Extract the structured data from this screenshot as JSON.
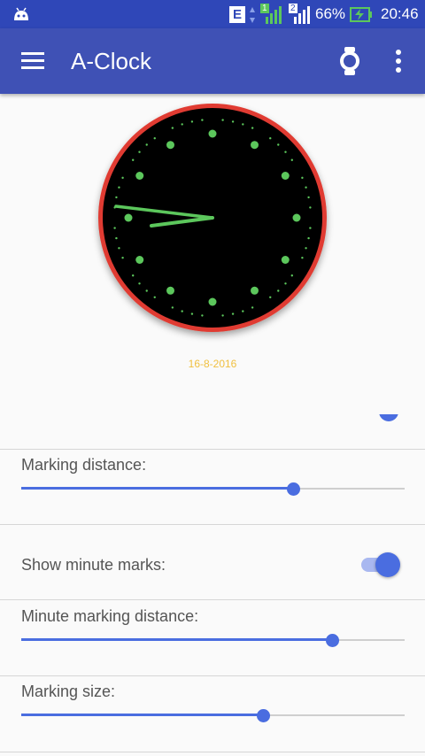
{
  "status_bar": {
    "network": "E",
    "sim1": "1",
    "sim2": "2",
    "battery": "66%",
    "time": "20:46"
  },
  "app_bar": {
    "title": "A-Clock"
  },
  "clock": {
    "date": "16-8-2016",
    "hour_hand_time": "9:45",
    "minute_hand_time": "9:45"
  },
  "settings": [
    {
      "label": "Marking distance:",
      "type": "slider",
      "value": 0.71
    },
    {
      "label": "Show minute marks:",
      "type": "toggle",
      "value": true
    },
    {
      "label": "Minute marking distance:",
      "type": "slider",
      "value": 0.81
    },
    {
      "label": "Marking size:",
      "type": "slider",
      "value": 0.63
    }
  ],
  "colors": {
    "primary": "#3f51b5",
    "status_bar": "#2f47b8",
    "accent": "#4a6de0",
    "dial_rim": "#e03b30",
    "dial_face": "#000000",
    "marks": "#5cc75c",
    "date": "#f0c040"
  }
}
